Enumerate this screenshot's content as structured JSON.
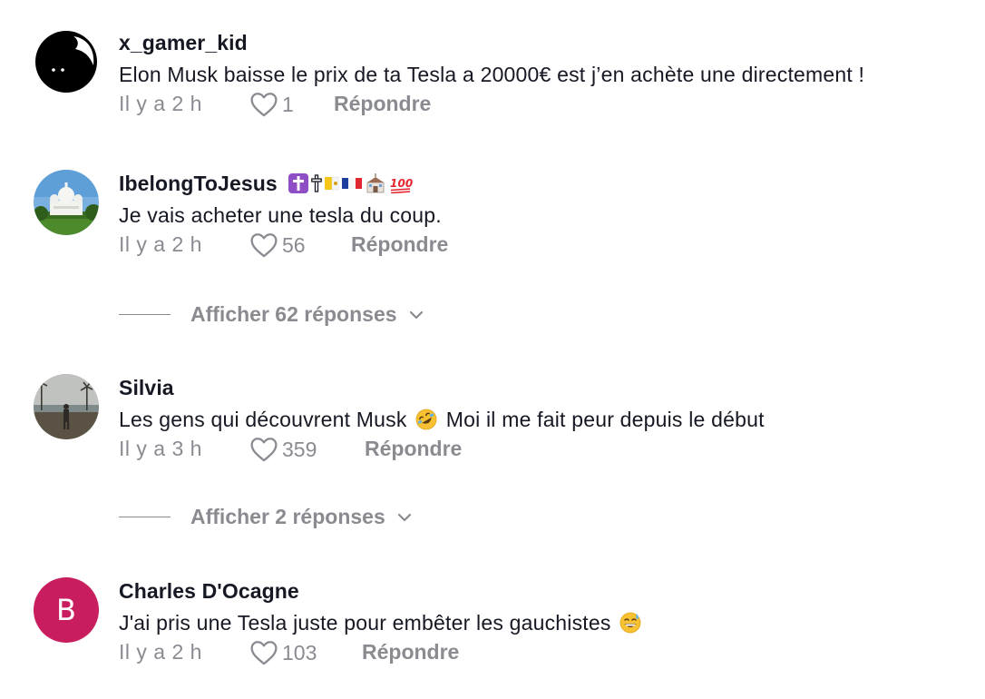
{
  "comments": [
    {
      "username": "x_gamer_kid",
      "text": "Elon Musk baisse le prix de ta Tesla a 20000€ est j’en achète une directement !",
      "time": "Il y a 2 h",
      "likes": "1",
      "reply_label": "Répondre",
      "avatar": "black-cat-avatar"
    },
    {
      "username": "IbelongToJesus",
      "badges": [
        "latin-cross-icon",
        "cross-icon",
        "vatican-flag-icon",
        "france-flag-icon",
        "church-icon",
        "hundred-points-icon"
      ],
      "text": "Je vais acheter une tesla du coup.",
      "time": "Il y a 2 h",
      "likes": "56",
      "reply_label": "Répondre",
      "avatar": "basilica-photo-avatar",
      "view_replies": "Afficher 62 réponses"
    },
    {
      "username": "Silvia",
      "text_before": "Les gens qui découvrent Musk",
      "emoji": "rolling-on-floor-laughing-emoji",
      "text_after": "Moi il me fait peur depuis le début",
      "time": "Il y a 3 h",
      "likes": "359",
      "reply_label": "Répondre",
      "avatar": "beach-photo-avatar",
      "view_replies": "Afficher 2 réponses"
    },
    {
      "username": "Charles D'Ocagne",
      "avatar_letter": "B",
      "text": "J'ai pris une Tesla juste pour embêter les gauchistes",
      "emoji": "grinning-sweat-emoji",
      "time": "Il y a 2 h",
      "likes": "103",
      "reply_label": "Répondre"
    }
  ],
  "colors": {
    "text": "#161823",
    "muted": "#8a8b91",
    "avatar_letter_bg": "#c81d5e"
  }
}
